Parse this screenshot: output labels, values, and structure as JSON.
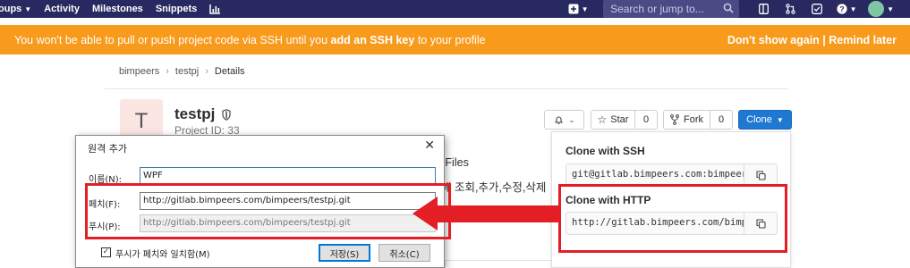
{
  "navbar": {
    "groups_label": "oups",
    "activity_label": "Activity",
    "milestones_label": "Milestones",
    "snippets_label": "Snippets",
    "search_placeholder": "Search or jump to..."
  },
  "banner": {
    "message_before": "You won't be able to pull or push project code via SSH until you ",
    "message_link": "add an SSH key",
    "message_after": " to your profile",
    "dont_show_label": "Don't show again",
    "separator": " | ",
    "remind_label": "Remind later"
  },
  "breadcrumb": {
    "group": "bimpeers",
    "project": "testpj",
    "current": "Details"
  },
  "project": {
    "avatar_letter": "T",
    "name": "testpj",
    "id_text": "Project ID: 33"
  },
  "actions": {
    "star_label": "Star",
    "star_count": "0",
    "fork_label": "Fork",
    "fork_count": "0",
    "clone_label": "Clone"
  },
  "clone": {
    "ssh_label": "Clone with SSH",
    "ssh_url": "git@gitlab.bimpeers.com:bimpeer",
    "http_label": "Clone with HTTP",
    "http_url": "http://gitlab.bimpeers.com/bimp"
  },
  "background_text": {
    "files": "3 Files",
    "korean_line": "해 조회,추가,수정,삭제"
  },
  "dialog": {
    "title": "원격 추가",
    "name_label": "이름(N):",
    "name_value": "WPF",
    "fetch_label": "페치(F):",
    "fetch_value": "http://gitlab.bimpeers.com/bimpeers/testpj.git",
    "push_label": "푸시(P):",
    "push_value": "http://gitlab.bimpeers.com/bimpeers/testpj.git",
    "checkbox_label": "푸시가 페치와 일치함(M)",
    "save_label": "저장(S)",
    "cancel_label": "취소(C)"
  },
  "colors": {
    "navbar": "#292961",
    "banner": "#f89a1c",
    "clone_button": "#1f78d1",
    "annotation": "#e31e24"
  }
}
